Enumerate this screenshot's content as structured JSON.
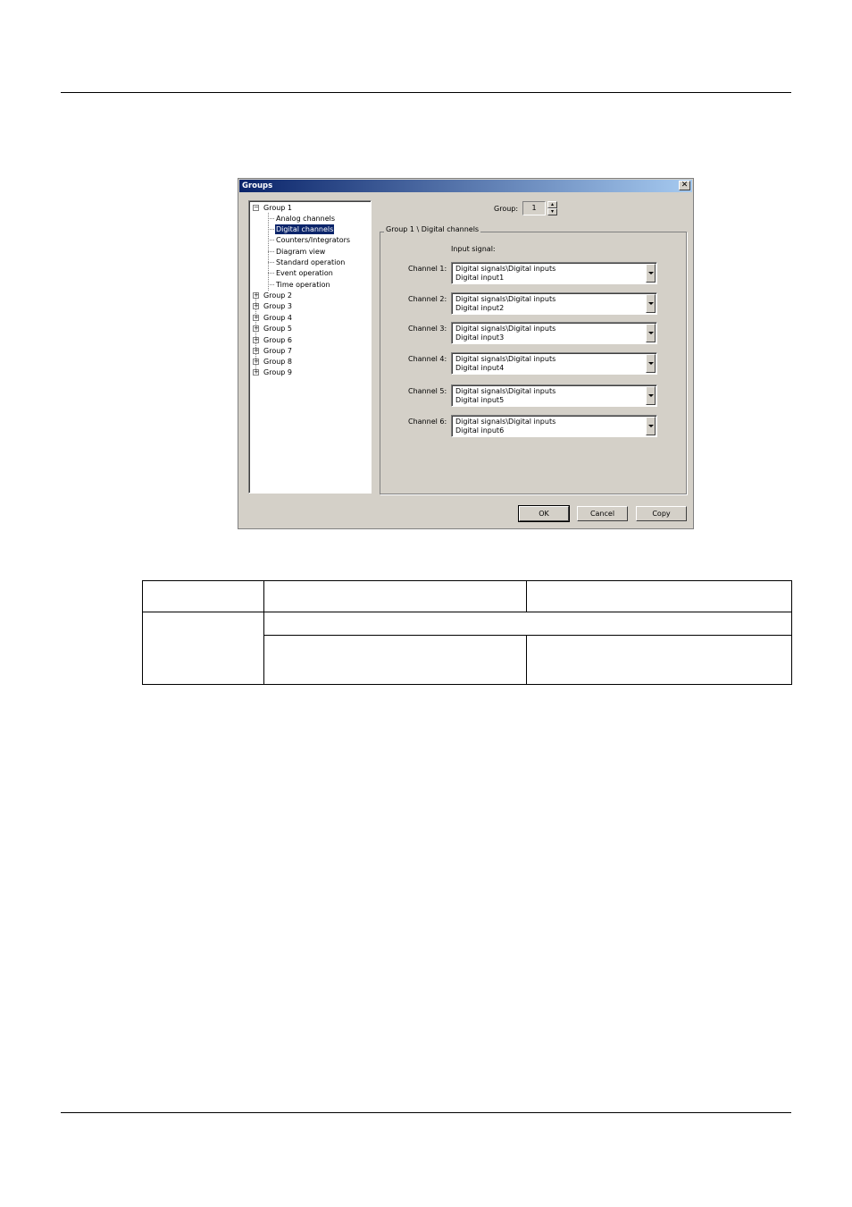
{
  "dialog": {
    "title": "Groups",
    "close_icon": "close-icon",
    "tree": {
      "expanded_group": "Group 1",
      "children": [
        "Analog channels",
        "Digital channels",
        "Counters/Integrators",
        "Diagram view",
        "Standard operation",
        "Event operation",
        "Time operation"
      ],
      "selected": "Digital channels",
      "collapsed_groups": [
        "Group 2",
        "Group 3",
        "Group 4",
        "Group 5",
        "Group 6",
        "Group 7",
        "Group 8",
        "Group 9"
      ]
    },
    "group_label": "Group:",
    "group_value": "1",
    "fieldset_legend": "Group 1 \\ Digital channels",
    "input_signal_label": "Input signal:",
    "channels": [
      {
        "label": "Channel 1:",
        "line1": "Digital signals\\Digital inputs",
        "line2": "Digital input1"
      },
      {
        "label": "Channel 2:",
        "line1": "Digital signals\\Digital inputs",
        "line2": "Digital input2"
      },
      {
        "label": "Channel 3:",
        "line1": "Digital signals\\Digital inputs",
        "line2": "Digital input3"
      },
      {
        "label": "Channel 4:",
        "line1": "Digital signals\\Digital inputs",
        "line2": "Digital input4"
      },
      {
        "label": "Channel 5:",
        "line1": "Digital signals\\Digital inputs",
        "line2": "Digital input5"
      },
      {
        "label": "Channel 6:",
        "line1": "Digital signals\\Digital inputs",
        "line2": "Digital input6"
      }
    ],
    "buttons": {
      "ok": "OK",
      "cancel": "Cancel",
      "copy": "Copy"
    }
  },
  "colors": {
    "dialog_face": "#d4d0c8",
    "titlebar_start": "#0a246a",
    "titlebar_end": "#a6caf0",
    "selection": "#0a246a"
  }
}
